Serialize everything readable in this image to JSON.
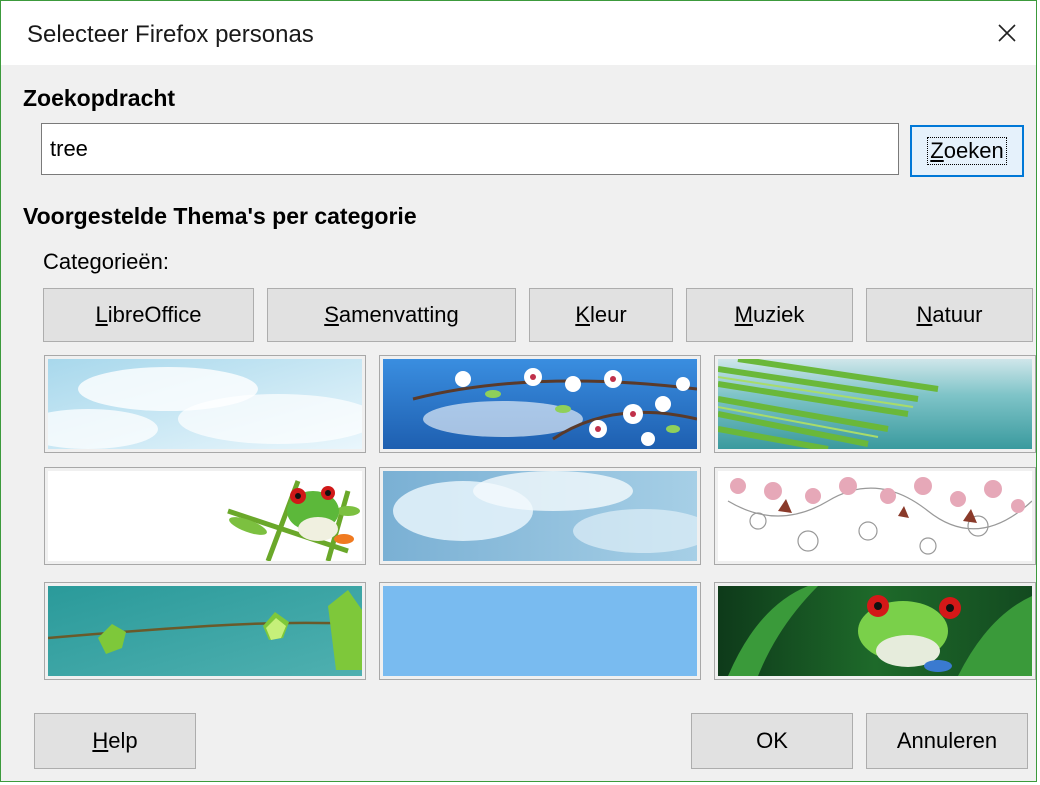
{
  "window": {
    "title": "Selecteer Firefox personas",
    "close_icon": "close-icon"
  },
  "search": {
    "heading": "Zoekopdracht",
    "value": "tree",
    "button": {
      "mnemonic": "Z",
      "rest": "oeken"
    }
  },
  "suggested": {
    "heading": "Voorgestelde Thema's per categorie",
    "categories_label": "Categorieën:",
    "categories": [
      {
        "before": "",
        "mnemonic": "L",
        "after": "ibreOffice"
      },
      {
        "before": "",
        "mnemonic": "S",
        "after": "amenvatting"
      },
      {
        "before": "",
        "mnemonic": "K",
        "after": "leur"
      },
      {
        "before": "",
        "mnemonic": "M",
        "after": "uziek"
      },
      {
        "before": "",
        "mnemonic": "N",
        "after": "atuur"
      }
    ],
    "themes": [
      "sky-clouds-theme",
      "cherry-blossom-sky-theme",
      "palm-leaf-sea-theme",
      "red-eyed-frog-white-theme",
      "blue-clouds-theme",
      "pink-blossom-swirl-theme",
      "green-vine-leaves-theme",
      "plain-light-blue-theme",
      "red-eyed-frog-green-theme"
    ]
  },
  "footer": {
    "help": {
      "mnemonic": "H",
      "rest": "elp"
    },
    "ok": "OK",
    "cancel": "Annuleren"
  },
  "colors": {
    "window_border": "#3c9a3c",
    "focus_blue": "#0078d7",
    "button_bg": "#e1e1e1"
  }
}
